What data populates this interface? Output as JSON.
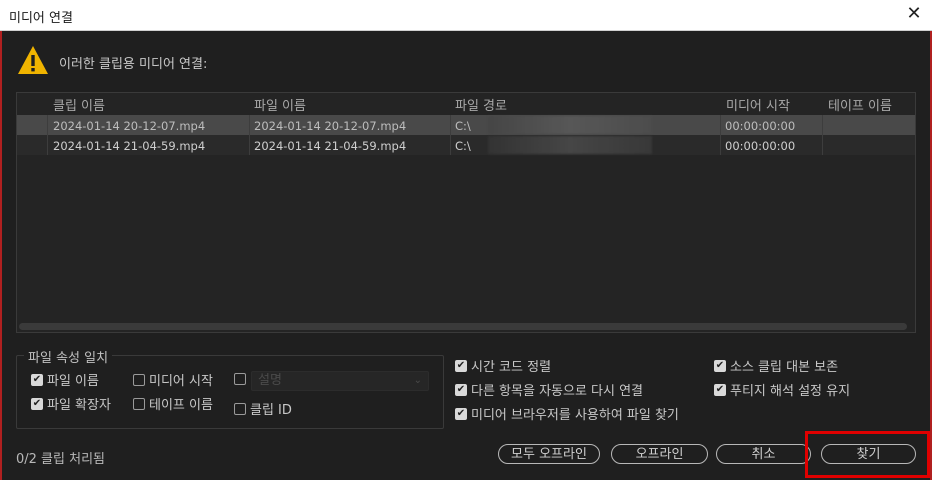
{
  "window": {
    "title": "미디어 연결",
    "close_glyph": "✕"
  },
  "heading": "이러한 클립용 미디어 연결:",
  "table": {
    "columns": [
      "클립 이름",
      "파일 이름",
      "파일 경로",
      "미디어 시작",
      "테이프 이름"
    ],
    "rows": [
      {
        "clip_name": "2024-01-14 20-12-07.mp4",
        "file_name": "2024-01-14 20-12-07.mp4",
        "file_path": "C:\\",
        "media_start": "00:00:00:00",
        "tape_name": ""
      },
      {
        "clip_name": "2024-01-14 21-04-59.mp4",
        "file_name": "2024-01-14 21-04-59.mp4",
        "file_path": "C:\\",
        "media_start": "00:00:00:00",
        "tape_name": ""
      }
    ]
  },
  "match": {
    "legend": "파일 속성 일치",
    "file_name": "파일 이름",
    "media_start": "미디어 시작",
    "description": "설명",
    "file_extension": "파일 확장자",
    "tape_name": "테이프 이름",
    "clip_id": "클립 ID"
  },
  "options": {
    "align_timecode": "시간 코드 정렬",
    "preserve_source": "소스 클립 대본 보존",
    "relink_others": "다른 항목을 자동으로 다시 연결",
    "preserve_interpret": "푸티지 해석 설정 유지",
    "use_media_browser": "미디어 브라우저를 사용하여 파일 찾기"
  },
  "status": "0/2 클립 처리됨",
  "buttons": {
    "offline_all": "모두 오프라인",
    "offline": "오프라인",
    "cancel": "취소",
    "locate": "찾기"
  },
  "colors": {
    "background": "#1f1f1f",
    "selected_row": "#494949",
    "highlight": "#e00000"
  }
}
